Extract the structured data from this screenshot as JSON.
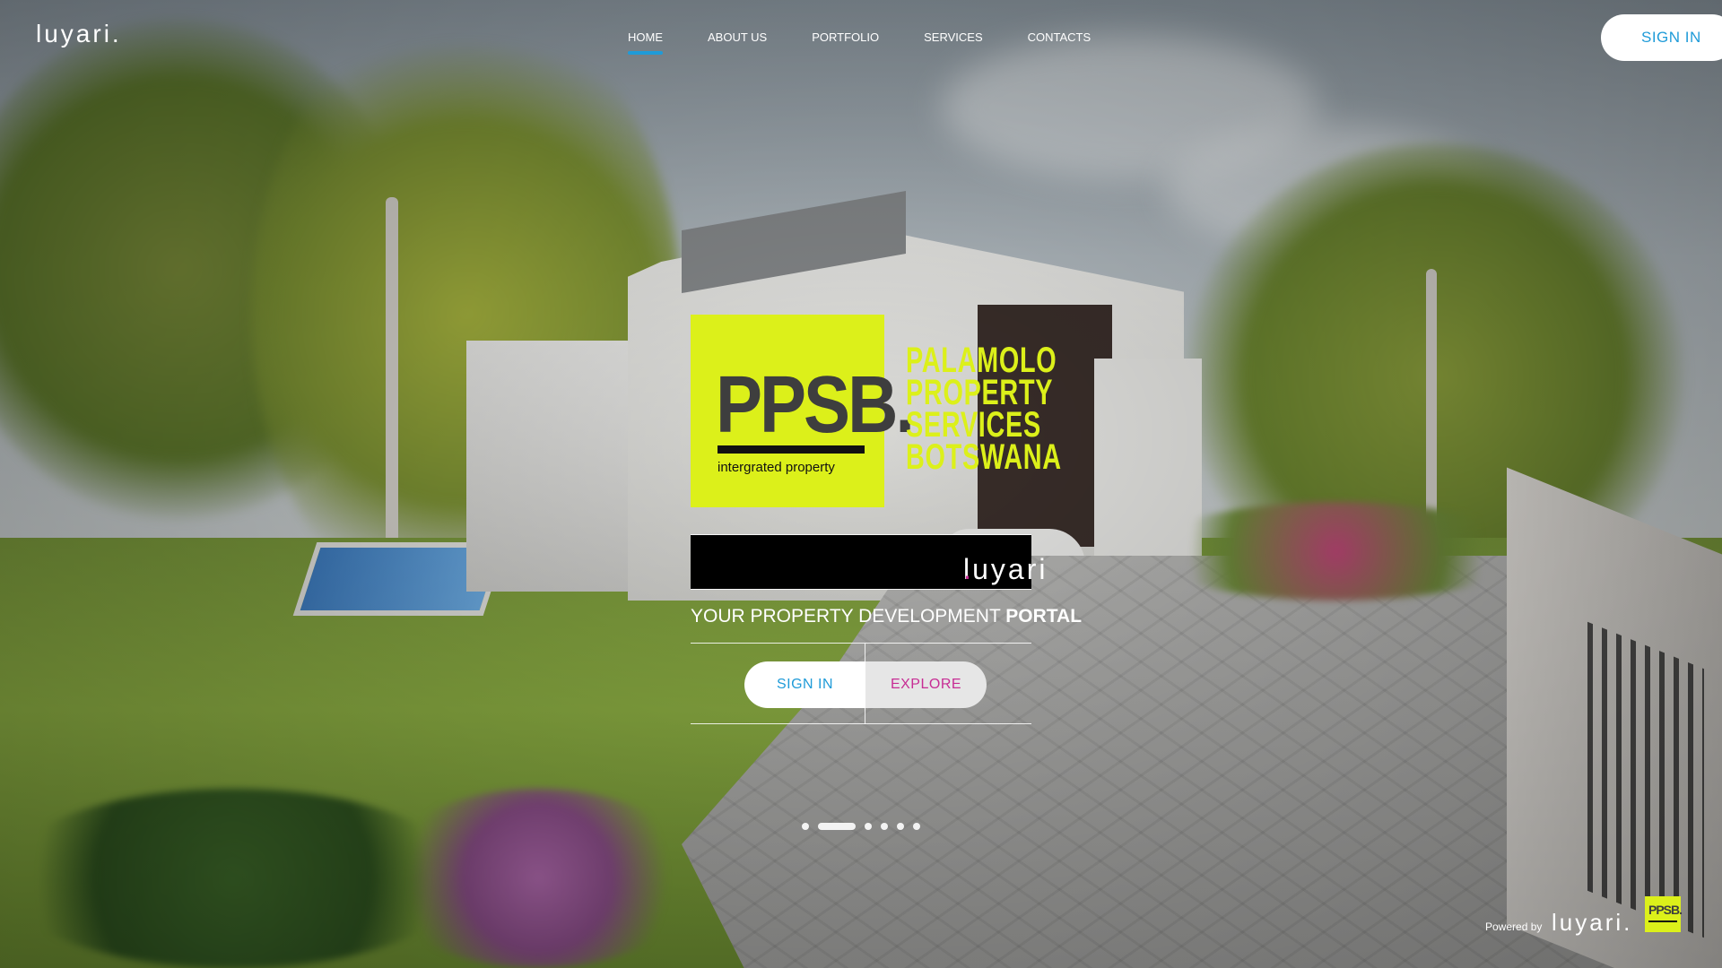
{
  "header": {
    "logo": "luyari",
    "logo_dot": ".",
    "nav": [
      {
        "label": "HOME",
        "active": true
      },
      {
        "label": "ABOUT US",
        "active": false
      },
      {
        "label": "PORTFOLIO",
        "active": false
      },
      {
        "label": "SERVICES",
        "active": false
      },
      {
        "label": "CONTACTS",
        "active": false
      }
    ],
    "sign_in": "SIGN IN"
  },
  "hero": {
    "ppsb_logo": {
      "mark": "PPSB.",
      "tagline": "intergrated property"
    },
    "company_lines": [
      "PALAMOLO",
      "PROPERTY",
      "SERVICES",
      "BOTSWANA"
    ],
    "luyari_logo": "luyari",
    "luyari_dot": ".",
    "tagline_regular": "YOUR PROPERTY DEVELOPMENT ",
    "tagline_bold": "PORTAL",
    "sign_in_button": "SIGN IN",
    "explore_button": "EXPLORE"
  },
  "slider": {
    "count": 6,
    "active_index": 1
  },
  "footer": {
    "powered_by": "Powered by",
    "brand": "luyari",
    "brand_dot": ".",
    "ppsb_badge": "PPSB."
  },
  "colors": {
    "accent_blue": "#1f9bd8",
    "accent_magenta": "#c72d94",
    "ppsb_yellow": "#dcf01a"
  },
  "icons": [
    "slider-dot-icon"
  ]
}
